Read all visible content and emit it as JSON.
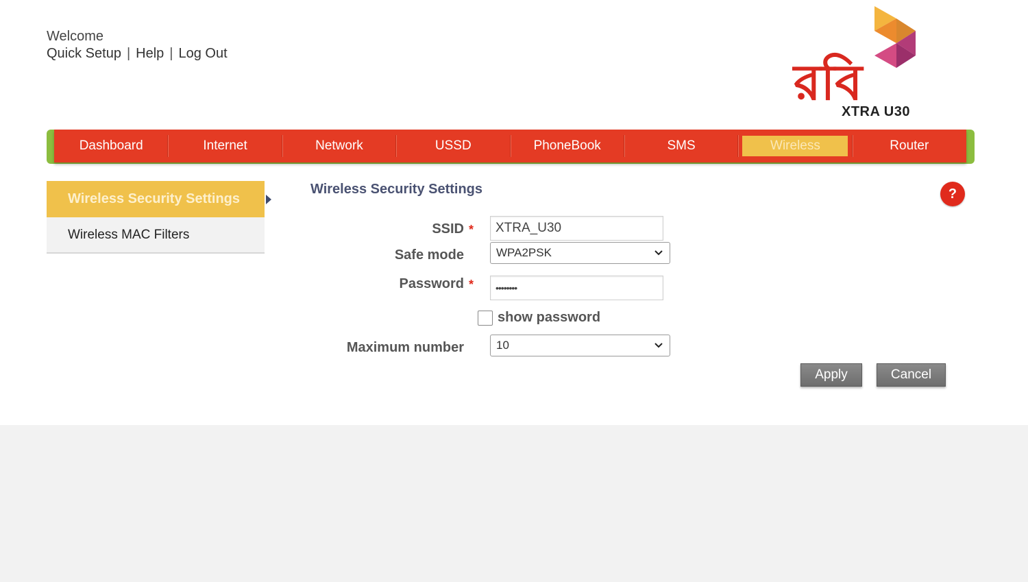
{
  "header": {
    "welcome": "Welcome",
    "links": [
      "Quick Setup",
      "Help",
      "Log Out"
    ],
    "separator": "|"
  },
  "logo": {
    "brand_text": "রবি",
    "model": "XTRA U30"
  },
  "nav": {
    "items": [
      "Dashboard",
      "Internet",
      "Network",
      "USSD",
      "PhoneBook",
      "SMS",
      "Wireless",
      "Router"
    ],
    "active": "Wireless"
  },
  "sidebar": {
    "items": [
      "Wireless Security Settings",
      "Wireless MAC Filters"
    ],
    "active": "Wireless Security Settings"
  },
  "content": {
    "title": "Wireless Security Settings",
    "help_label": "?",
    "required_mark": "*",
    "form": {
      "ssid_label": "SSID",
      "ssid_value": "XTRA_U30",
      "safe_mode_label": "Safe mode",
      "safe_mode_value": "WPA2PSK",
      "password_label": "Password",
      "password_value": "••••••••",
      "show_password_label": "show password",
      "show_password_checked": false,
      "max_number_label": "Maximum number",
      "max_number_value": "10"
    },
    "buttons": {
      "apply": "Apply",
      "cancel": "Cancel"
    }
  },
  "colors": {
    "nav_red": "#e43b24",
    "accent_yellow": "#f0c14b",
    "nav_green_edge": "#8cbd3f",
    "help_red": "#e02a1c",
    "button_gray": "#7a7a7a"
  }
}
